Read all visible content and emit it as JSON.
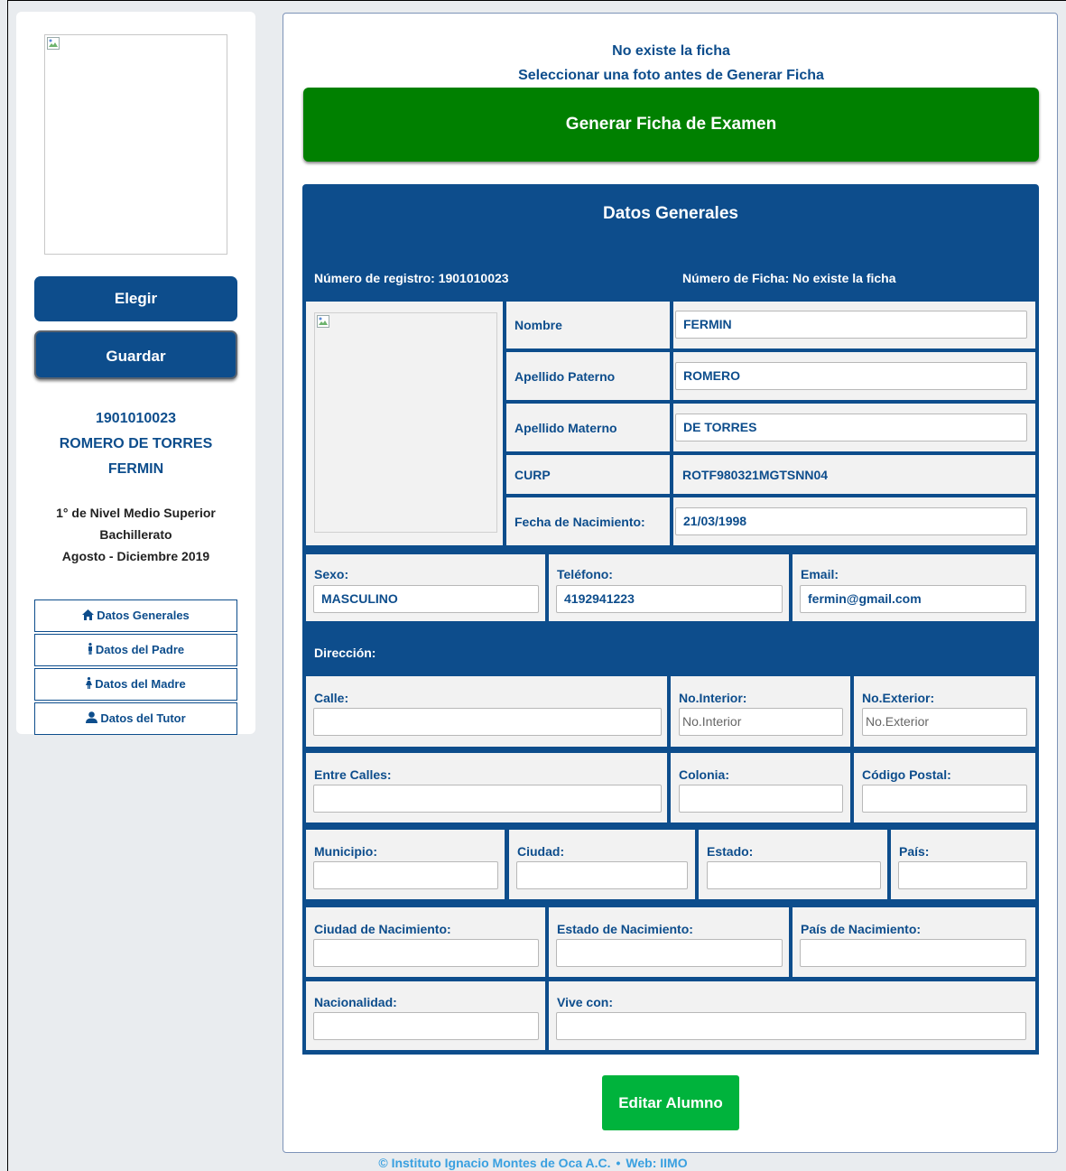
{
  "sidebar": {
    "elegir_label": "Elegir",
    "guardar_label": "Guardar",
    "student_id": "1901010023",
    "student_lastnames": "ROMERO DE TORRES",
    "student_firstname": "FERMIN",
    "level": "1° de Nivel Medio Superior",
    "program": "Bachillerato",
    "period": "Agosto - Diciembre 2019",
    "nav": [
      {
        "label": "Datos Generales",
        "icon": "home-icon"
      },
      {
        "label": "Datos del Padre",
        "icon": "male-icon"
      },
      {
        "label": "Datos del Madre",
        "icon": "female-icon"
      },
      {
        "label": "Datos del Tutor",
        "icon": "user-icon"
      }
    ]
  },
  "notice": {
    "line1": "No existe la ficha",
    "line2": "Seleccionar una foto antes de Generar Ficha"
  },
  "generar_label": "Generar Ficha de Examen",
  "datos": {
    "title": "Datos Generales",
    "registro": "Número de registro: 1901010023",
    "ficha": "Número de Ficha: No existe la ficha",
    "nombre_label": "Nombre",
    "nombre_value": "FERMIN",
    "paterno_label": "Apellido Paterno",
    "paterno_value": "ROMERO",
    "materno_label": "Apellido Materno",
    "materno_value": "DE TORRES",
    "curp_label": "CURP",
    "curp_value": "ROTF980321MGTSNN04",
    "nacimiento_label": "Fecha de Nacimiento:",
    "nacimiento_value": "21/03/1998",
    "sexo_label": "Sexo:",
    "sexo_value": "MASCULINO",
    "telefono_label": "Teléfono:",
    "telefono_value": "4192941223",
    "email_label": "Email:",
    "email_value": "fermin@gmail.com",
    "direccion_label": "Dirección:",
    "calle_label": "Calle:",
    "calle_value": "",
    "no_interior_label": "No.Interior:",
    "no_interior_placeholder": "No.Interior",
    "no_exterior_label": "No.Exterior:",
    "no_exterior_placeholder": "No.Exterior",
    "entre_calles_label": "Entre Calles:",
    "colonia_label": "Colonia:",
    "cp_label": "Código Postal:",
    "municipio_label": "Municipio:",
    "ciudad_label": "Ciudad:",
    "estado_label": "Estado:",
    "pais_label": "País:",
    "ciudad_nac_label": "Ciudad de Nacimiento:",
    "estado_nac_label": "Estado de Nacimiento:",
    "pais_nac_label": "País de Nacimiento:",
    "nacionalidad_label": "Nacionalidad:",
    "vive_con_label": "Vive con:"
  },
  "editar_label": "Editar Alumno",
  "footer": {
    "copyright": "© Instituto Ignacio Montes de Oca A.C.",
    "sep": "•",
    "web_label": "Web:",
    "web_link": "IIMO"
  },
  "colors": {
    "primary": "#0d4d8c",
    "generar": "#008000",
    "editar": "#00b33c",
    "footer": "#3aa0e0"
  }
}
